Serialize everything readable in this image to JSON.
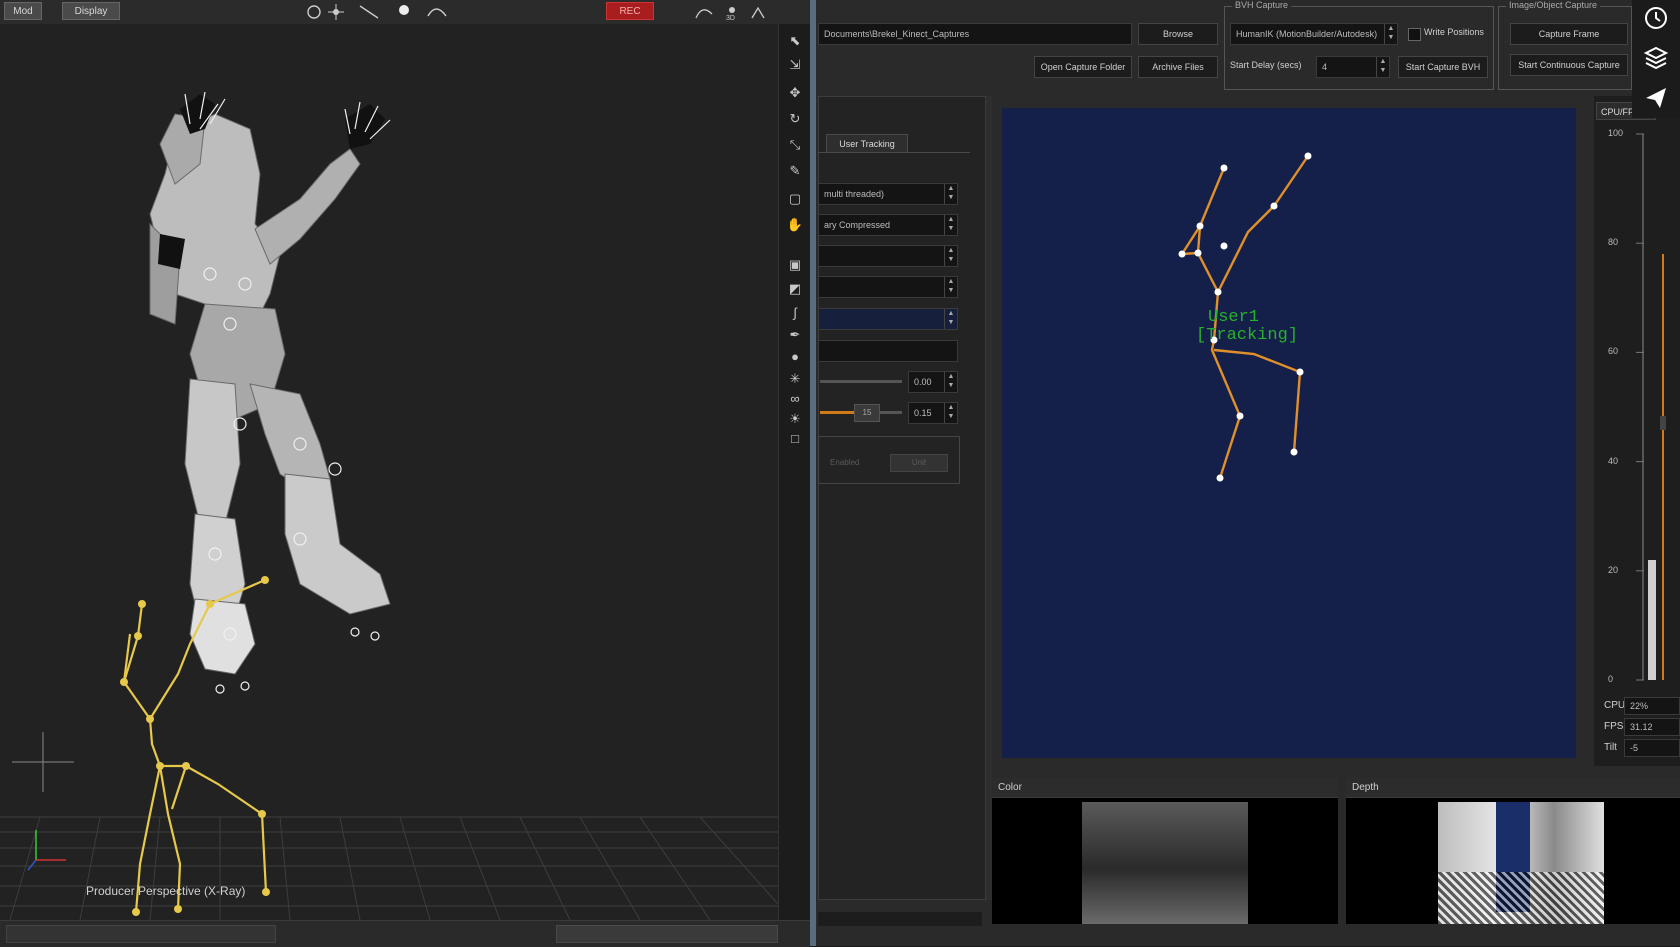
{
  "left": {
    "toolbar": {
      "btn_a": "Mod",
      "btn_b": "Display",
      "record_label": "REC"
    },
    "viewport_label": "Producer Perspective (X-Ray)",
    "tools": [
      "select-icon",
      "translate-icon",
      "move-icon",
      "rotate-icon",
      "scale-icon",
      "pencil-icon",
      "frame-icon",
      "hand-icon",
      "cube-icon",
      "cube-fill-icon",
      "curve-icon",
      "pen-icon",
      "sphere-icon",
      "axes-icon",
      "glasses-icon",
      "light-icon",
      "box-icon"
    ]
  },
  "right": {
    "path_value": "Documents\\Brekel_Kinect_Captures",
    "browse_label": "Browse",
    "open_folder_label": "Open Capture Folder",
    "archive_label": "Archive Files",
    "bvh_group_title": "BVH Capture",
    "bvh_mode_value": "HumanIK (MotionBuilder/Autodesk)",
    "write_positions_label": "Write Positions",
    "start_delay_label": "Start Delay (secs)",
    "start_delay_value": "4",
    "start_capture_bvh_label": "Start Capture BVH",
    "image_group_title": "Image/Object Capture",
    "capture_frame_label": "Capture Frame",
    "continuous_label": "Start Continuous Capture",
    "tab_label": "User Tracking",
    "settings": {
      "row1": "multi threaded)",
      "row2": "ary Compressed",
      "value_a": "0.00",
      "value_b": "0.15",
      "slider_mark": "15",
      "disabled_label": "Enabled",
      "disabled_btn": "Unit"
    },
    "user_label_1": "User1",
    "user_label_2": "[Tracking]",
    "color_title": "Color",
    "depth_title": "Depth",
    "meter": {
      "title": "CPU/FPS",
      "ticks": [
        "100",
        "80",
        "60",
        "40",
        "20",
        "0"
      ],
      "cpu_level": 0.22,
      "fps_level": 0.78
    },
    "stats": {
      "cpu_label": "CPU",
      "cpu_value": "22%",
      "fps_label": "FPS",
      "fps_value": "31.12",
      "tilt_label": "Tilt",
      "tilt_value": "-5"
    },
    "corner_icons": [
      "clock-icon",
      "layers-icon",
      "send-icon"
    ]
  }
}
